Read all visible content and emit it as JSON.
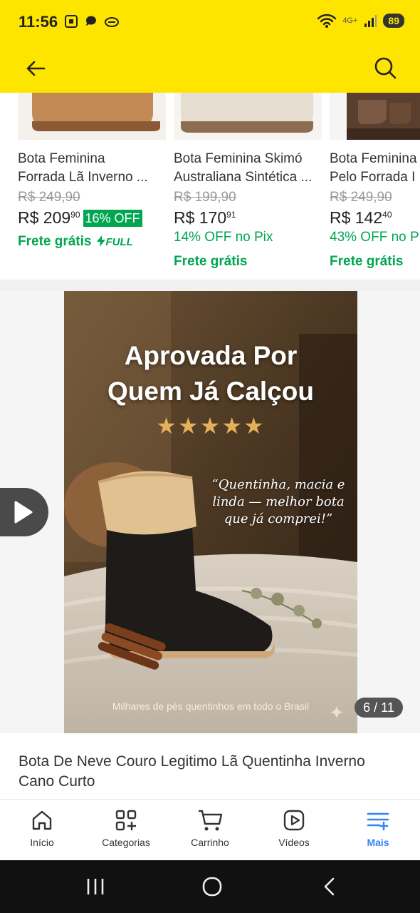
{
  "status_bar": {
    "time": "11:56",
    "network": "4G+",
    "battery": "89"
  },
  "colors": {
    "brand_yellow": "#fde500",
    "accent_green": "#00a650",
    "accent_blue": "#3483fa"
  },
  "related_products": [
    {
      "title_line1": "Bota Feminina",
      "title_line2": "Forrada Lã Inverno ...",
      "old_price": "R$ 249,90",
      "price_whole": "R$ 209",
      "price_cents": "90",
      "discount": "16% OFF",
      "shipping": "Frete grátis",
      "shipping_badge": "FULL"
    },
    {
      "title_line1": "Bota Feminina Skimó",
      "title_line2": "Australiana Sintética ...",
      "old_price": "R$ 199,90",
      "price_whole": "R$ 170",
      "price_cents": "91",
      "pix_discount": "14% OFF no Pix",
      "shipping": "Frete grátis"
    },
    {
      "title_line1": "Bota Feminina",
      "title_line2": "Pelo Forrada I",
      "old_price": "R$ 249,90",
      "price_whole": "R$ 142",
      "price_cents": "40",
      "pix_discount": "43% OFF no P",
      "shipping": "Frete grátis"
    }
  ],
  "gallery": {
    "headline_line1": "Aprovada Por",
    "headline_line2": "Quem Já Calçou",
    "stars": "★★★★★",
    "quote_line1": "“Quentinha, macia e",
    "quote_line2": "linda — melhor bota",
    "quote_line3": "que já comprei!”",
    "caption": "Milhares de pés quentinhos em todo o Brasil",
    "page_indicator": "6 / 11"
  },
  "item": {
    "title": "Bota De Neve Couro Legitimo Lã Quentinha Inverno Cano Curto"
  },
  "bottom_nav": [
    {
      "label": "Início",
      "icon": "home-icon"
    },
    {
      "label": "Categorias",
      "icon": "categories-icon"
    },
    {
      "label": "Carrinho",
      "icon": "cart-icon"
    },
    {
      "label": "Vídeos",
      "icon": "video-icon"
    },
    {
      "label": "Mais",
      "icon": "more-menu-icon"
    }
  ]
}
